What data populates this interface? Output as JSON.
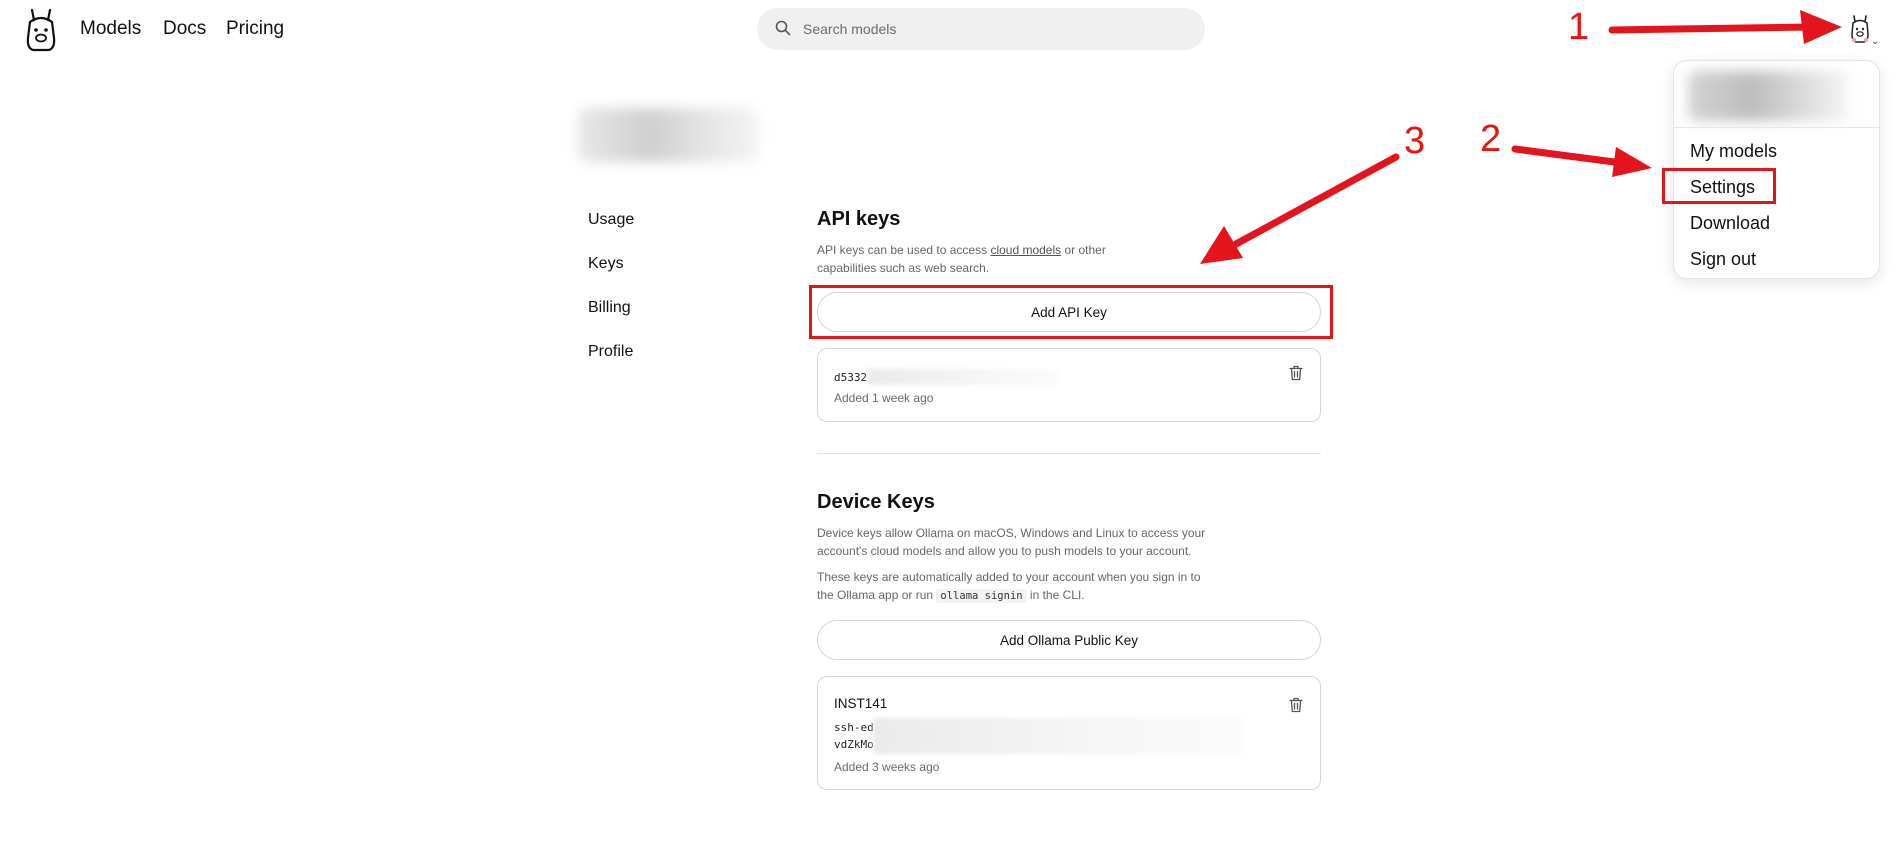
{
  "header": {
    "nav": [
      "Models",
      "Docs",
      "Pricing"
    ],
    "search_placeholder": "Search models"
  },
  "settings_nav": [
    "Usage",
    "Keys",
    "Billing",
    "Profile"
  ],
  "api_keys": {
    "title": "API keys",
    "desc_part1": "API keys can be used to access ",
    "desc_link": "cloud models",
    "desc_part2": " or other capabilities such as web search.",
    "add_button": "Add API Key",
    "key_prefix": "d5332",
    "key_added": "Added 1 week ago"
  },
  "device_keys": {
    "title": "Device Keys",
    "desc1": "Device keys allow Ollama on macOS, Windows and Linux to access your account's cloud models and allow you to push models to your account.",
    "desc2_part1": "These keys are automatically added to your account when you sign in to the Ollama app or run ",
    "desc2_code": "ollama signin",
    "desc2_part2": " in the CLI.",
    "add_button": "Add Ollama Public Key",
    "key_name": "INST141",
    "key_line1": "ssh-ed",
    "key_line2": "vdZkMo",
    "key_added": "Added 3 weeks ago"
  },
  "user_menu": {
    "items": [
      "My models",
      "Settings",
      "Download",
      "Sign out"
    ]
  },
  "annotations": [
    "1",
    "2",
    "3"
  ],
  "colors": {
    "annotation": "#e3141b",
    "search_bg": "#f0f0f0",
    "border": "#d6d6d6"
  },
  "icons": [
    "llama-logo-icon",
    "search-icon",
    "avatar-icon",
    "chevron-down-icon",
    "trash-icon"
  ]
}
